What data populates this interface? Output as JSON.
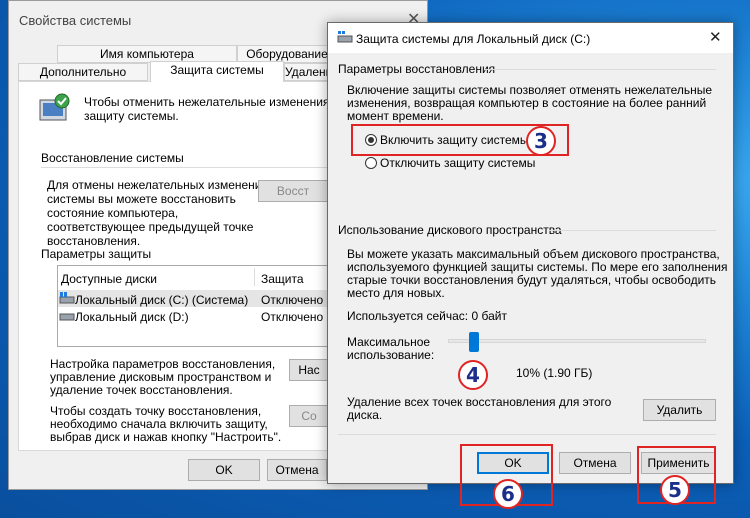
{
  "bg_window": {
    "title": "Свойства системы",
    "tabs_top": [
      "Имя компьютера",
      "Оборудование"
    ],
    "tabs_bottom": [
      "Дополнительно",
      "Защита системы",
      "Удаленный доступ"
    ],
    "intro": "Чтобы отменить нежелательные изменения, используйте защиту системы.",
    "intro_lines": [
      "Чтобы отменить нежелательные изменения, ис",
      "защиту системы."
    ],
    "restore_heading": "Восстановление системы",
    "restore_lines": [
      "Для отмены нежелательных изменений",
      "системы вы можете восстановить",
      "состояние компьютера,",
      "соответствующее предыдущей точке",
      "восстановления."
    ],
    "restore_button": "Восст",
    "protection_heading": "Параметры защиты",
    "list_headers": [
      "Доступные диски",
      "Защита"
    ],
    "drives": [
      {
        "name": "Локальный диск (C:) (Система)",
        "state": "Отключено"
      },
      {
        "name": "Локальный диск (D:)",
        "state": "Отключено"
      }
    ],
    "config_lines": [
      "Настройка параметров восстановления,",
      "управление дисковым пространством и",
      "удаление точек восстановления."
    ],
    "config_button": "Нас",
    "create_lines": [
      "Чтобы создать точку восстановления,",
      "необходимо сначала включить защиту,",
      "выбрав диск и нажав кнопку \"Настроить\"."
    ],
    "create_button": "Со",
    "ok": "OK",
    "cancel": "Отмена"
  },
  "dialog": {
    "title": "Защита системы для Локальный диск (C:)",
    "close": "✕",
    "restore_group": "Параметры восстановления",
    "restore_desc": [
      "Включение защиты системы позволяет отменять нежелательные",
      "изменения, возвращая компьютер в состояние на более ранний",
      "момент времени."
    ],
    "radio_on": "Включить защиту системы",
    "radio_off": "Отключить защиту системы",
    "disk_group": "Использование дискового пространства",
    "disk_desc": [
      "Вы можете указать максимальный объем дискового пространства,",
      "используемого функцией защиты системы. По мере его заполнения",
      "старые точки восстановления будут удаляться, чтобы освободить",
      "место для новых."
    ],
    "current_usage": "Используется сейчас:  0 байт",
    "max_label": [
      "Максимальное",
      "использование:"
    ],
    "slider_value": "10% (1.90 ГБ)",
    "slider_fraction": 0.1,
    "delete_desc": [
      "Удаление всех точек восстановления для этого",
      "диска."
    ],
    "delete_button": "Удалить",
    "ok": "OK",
    "cancel": "Отмена",
    "apply": "Применить"
  },
  "markers": [
    "3",
    "4",
    "5",
    "6"
  ],
  "colors": {
    "accent_red": "#e02424",
    "marker_text": "#1a2e8a",
    "ok_border": "#0078d7"
  }
}
